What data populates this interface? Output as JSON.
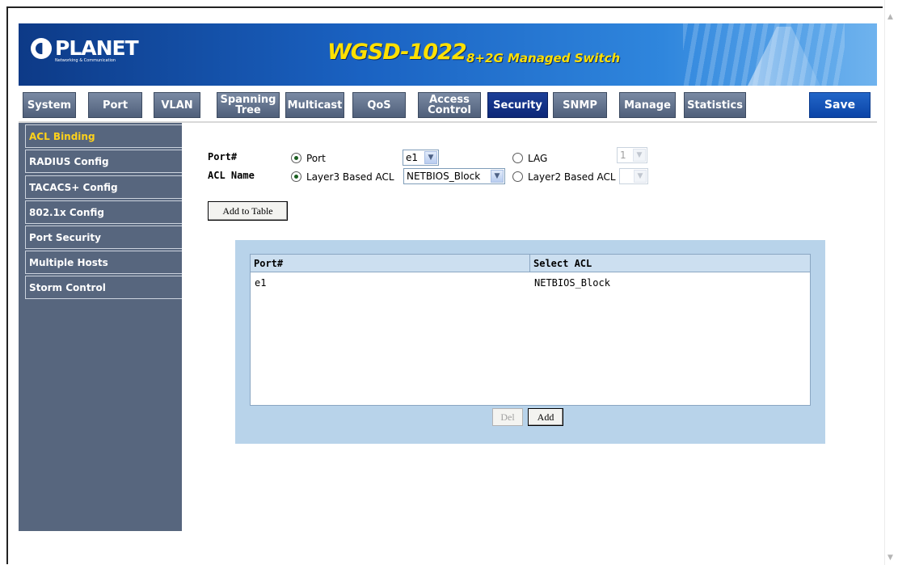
{
  "banner": {
    "logo": "PLANET",
    "logo_tagline": "Networking & Communication",
    "product": "WGSD-1022",
    "product_desc": "8+2G Managed Switch"
  },
  "nav": {
    "system": "System",
    "port": "Port",
    "vlan": "VLAN",
    "spanning_tree_1": "Spanning",
    "spanning_tree_2": "Tree",
    "multicast": "Multicast",
    "qos": "QoS",
    "access_control_1": "Access",
    "access_control_2": "Control",
    "security": "Security",
    "snmp": "SNMP",
    "manage": "Manage",
    "statistics": "Statistics",
    "save": "Save"
  },
  "sidebar": {
    "items": [
      {
        "label": "ACL Binding"
      },
      {
        "label": "RADIUS Config"
      },
      {
        "label": "TACACS+ Config"
      },
      {
        "label": "802.1x Config"
      },
      {
        "label": "Port Security"
      },
      {
        "label": "Multiple Hosts"
      },
      {
        "label": "Storm Control"
      }
    ]
  },
  "form": {
    "port_label": "Port#",
    "acl_name_label": "ACL Name",
    "port_option": "Port",
    "port_value": "e1",
    "lag_option": "LAG",
    "lag_value": "1",
    "layer3_option": "Layer3 Based ACL",
    "layer3_value": "NETBIOS_Block",
    "layer2_option": "Layer2 Based ACL",
    "layer2_value": "",
    "add_to_table": "Add to Table"
  },
  "table": {
    "headers": [
      "Port#",
      "Select ACL"
    ],
    "rows": [
      {
        "port": "e1",
        "acl": "NETBIOS_Block"
      }
    ],
    "del_label": "Del",
    "add_label": "Add"
  }
}
